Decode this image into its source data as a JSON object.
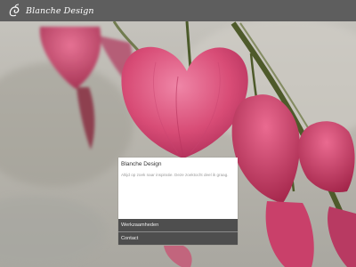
{
  "site": {
    "logo_text": "Blanche Design",
    "logo_icon": "flower-swirl-logo-icon"
  },
  "panel": {
    "title": "Blanche Design",
    "text": "Altijd op zoek naar inspiratie. Deze zoektocht deel ik graag."
  },
  "nav": {
    "items": [
      {
        "label": "Werkzaamheden"
      },
      {
        "label": "Contact"
      }
    ]
  },
  "colors": {
    "topbar": "#5e5e5e",
    "nav_item": "#4e4e4e",
    "panel_bg": "#ffffff",
    "flower_pink": "#d1456e",
    "stem_green": "#4e5a2a"
  }
}
